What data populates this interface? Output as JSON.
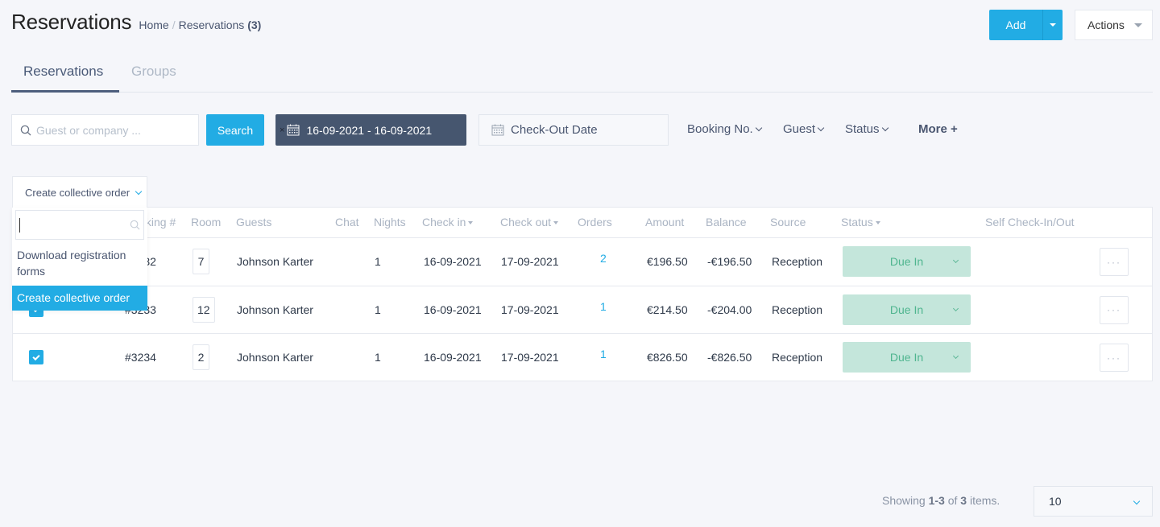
{
  "header": {
    "title": "Reservations",
    "breadcrumb": {
      "home": "Home",
      "separator": "/",
      "current": "Reservations",
      "count": "(3)"
    },
    "add_label": "Add",
    "actions_label": "Actions"
  },
  "tabs": [
    {
      "label": "Reservations",
      "active": true
    },
    {
      "label": "Groups",
      "active": false
    }
  ],
  "filters": {
    "search_placeholder": "Guest or company ...",
    "search_value": "",
    "search_button": "Search",
    "date_range_value": "16-09-2021 - 16-09-2021",
    "clear_glyph": "×",
    "checkout_placeholder": "Check-Out Date",
    "booking_no": "Booking No.",
    "guest": "Guest",
    "status": "Status",
    "more": "More +"
  },
  "bulk_action": {
    "selected": "Create collective order",
    "search_value": "",
    "options": [
      {
        "label": "Download registration forms",
        "active": false
      },
      {
        "label": "Create collective order",
        "active": true
      }
    ]
  },
  "table": {
    "columns": {
      "booking": "Booking #",
      "room": "Room",
      "guests": "Guests",
      "chat": "Chat",
      "nights": "Nights",
      "check_in": "Check in",
      "check_out": "Check out",
      "orders": "Orders",
      "amount": "Amount",
      "balance": "Balance",
      "source": "Source",
      "status": "Status",
      "self_check": "Self Check-In/Out"
    },
    "rows": [
      {
        "checked": true,
        "booking": "#3232",
        "room": "7",
        "guest": "Johnson Karter",
        "nights": "1",
        "check_in": "16-09-2021",
        "check_out": "17-09-2021",
        "orders": "2",
        "amount": "€196.50",
        "balance": "-€196.50",
        "source": "Reception",
        "status": "Due In",
        "more": "···"
      },
      {
        "checked": true,
        "booking": "#3233",
        "room": "12",
        "guest": "Johnson Karter",
        "nights": "1",
        "check_in": "16-09-2021",
        "check_out": "17-09-2021",
        "orders": "1",
        "amount": "€214.50",
        "balance": "-€204.00",
        "source": "Reception",
        "status": "Due In",
        "more": "···"
      },
      {
        "checked": true,
        "booking": "#3234",
        "room": "2",
        "guest": "Johnson Karter",
        "nights": "1",
        "check_in": "16-09-2021",
        "check_out": "17-09-2021",
        "orders": "1",
        "amount": "€826.50",
        "balance": "-€826.50",
        "source": "Reception",
        "status": "Due In",
        "more": "···"
      }
    ]
  },
  "footer": {
    "showing_prefix": "Showing",
    "range": "1-3",
    "of": "of",
    "total": "3",
    "suffix": "items.",
    "page_size": "10"
  },
  "colors": {
    "primary": "#22ace4",
    "date_filter_bg": "#46566f",
    "status_bg": "#c4e6db",
    "status_text": "#4fb58f"
  }
}
